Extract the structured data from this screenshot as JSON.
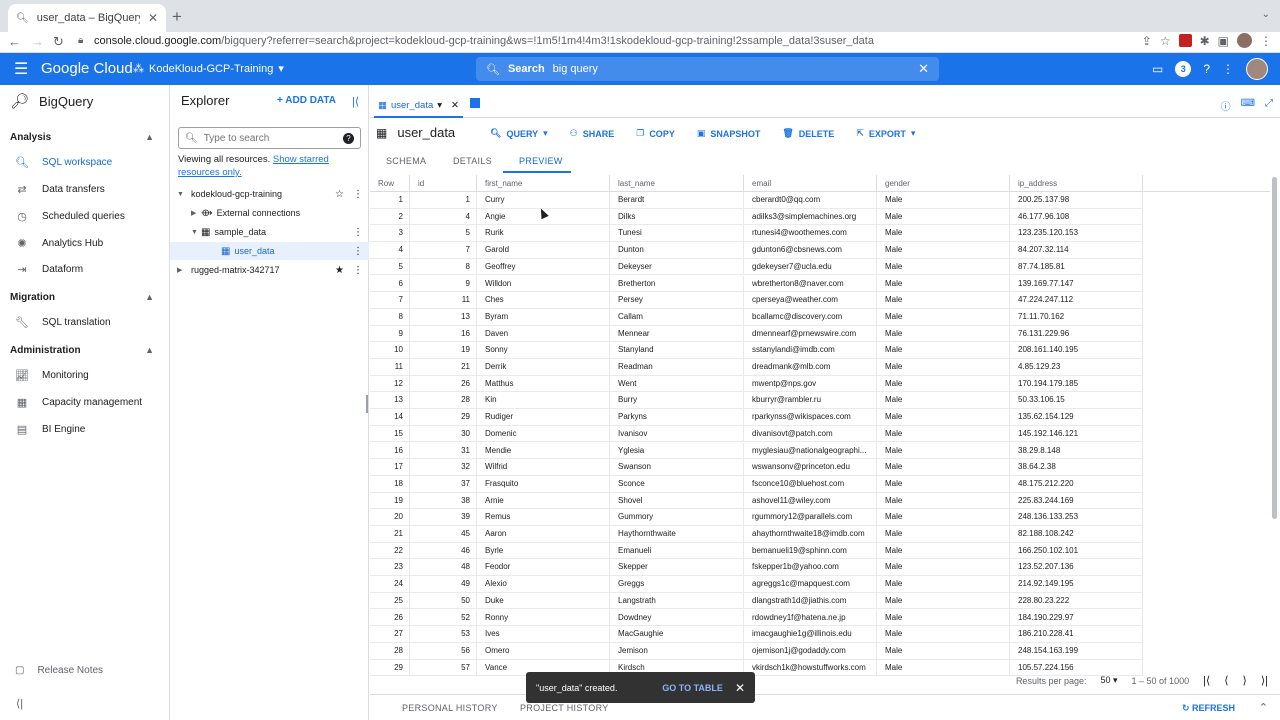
{
  "browser": {
    "tab_title": "user_data – BigQuery – Kode",
    "url_host": "console.cloud.google.com",
    "url_rest": "/bigquery?referrer=search&project=kodekloud-gcp-training&ws=!1m5!1m4!4m3!1skodekloud-gcp-training!2ssample_data!3suser_data",
    "icons": [
      "back-icon",
      "forward-icon",
      "reload-icon",
      "lock-icon",
      "new-tab-icon"
    ]
  },
  "gcp": {
    "logo": "Google Cloud",
    "project": "KodeKloud-GCP-Training",
    "search_label": "Search",
    "search_query": "big query",
    "notification_count": "3",
    "brand_color": "#1a73e8"
  },
  "leftnav": {
    "product": "BigQuery",
    "sections": [
      {
        "title": "Analysis",
        "items": [
          "SQL workspace",
          "Data transfers",
          "Scheduled queries",
          "Analytics Hub",
          "Dataform"
        ]
      },
      {
        "title": "Migration",
        "items": [
          "SQL translation"
        ]
      },
      {
        "title": "Administration",
        "items": [
          "Monitoring",
          "Capacity management",
          "BI Engine"
        ]
      }
    ],
    "release_notes": "Release Notes"
  },
  "explorer": {
    "title": "Explorer",
    "add_data": "ADD DATA",
    "search_placeholder": "Type to search",
    "viewing": "Viewing all resources.",
    "starred_link": "Show starred resources only.",
    "tree": [
      {
        "label": "kodekloud-gcp-training"
      },
      {
        "label": "External connections"
      },
      {
        "label": "sample_data"
      },
      {
        "label": "user_data"
      },
      {
        "label": "rugged-matrix-342717"
      }
    ]
  },
  "main": {
    "tab_label": "user_data",
    "table_name": "user_data",
    "toolbar": [
      "QUERY",
      "SHARE",
      "COPY",
      "SNAPSHOT",
      "DELETE",
      "EXPORT"
    ],
    "subtabs": [
      "SCHEMA",
      "DETAILS",
      "PREVIEW"
    ],
    "columns": [
      "Row",
      "id",
      "first_name",
      "last_name",
      "email",
      "gender",
      "ip_address"
    ],
    "rows": [
      [
        "1",
        "1",
        "Curry",
        "Berardt",
        "cberardt0@qq.com",
        "Male",
        "200.25.137.98"
      ],
      [
        "2",
        "4",
        "Angie",
        "Dilks",
        "adilks3@simplemachines.org",
        "Male",
        "46.177.96.108"
      ],
      [
        "3",
        "5",
        "Rurik",
        "Tunesi",
        "rtunesi4@woothemes.com",
        "Male",
        "123.235.120.153"
      ],
      [
        "4",
        "7",
        "Garold",
        "Dunton",
        "gdunton6@cbsnews.com",
        "Male",
        "84.207.32.114"
      ],
      [
        "5",
        "8",
        "Geoffrey",
        "Dekeyser",
        "gdekeyser7@ucla.edu",
        "Male",
        "87.74.185.81"
      ],
      [
        "6",
        "9",
        "Willdon",
        "Bretherton",
        "wbretherton8@naver.com",
        "Male",
        "139.169.77.147"
      ],
      [
        "7",
        "11",
        "Ches",
        "Persey",
        "cperseya@weather.com",
        "Male",
        "47.224.247.112"
      ],
      [
        "8",
        "13",
        "Byram",
        "Callam",
        "bcallamc@discovery.com",
        "Male",
        "71.11.70.162"
      ],
      [
        "9",
        "16",
        "Daven",
        "Mennear",
        "dmennearf@prnewswire.com",
        "Male",
        "76.131.229.96"
      ],
      [
        "10",
        "19",
        "Sonny",
        "Stanyland",
        "sstanylandi@imdb.com",
        "Male",
        "208.161.140.195"
      ],
      [
        "11",
        "21",
        "Derrik",
        "Readman",
        "dreadmank@mlb.com",
        "Male",
        "4.85.129.23"
      ],
      [
        "12",
        "26",
        "Matthus",
        "Went",
        "mwentp@nps.gov",
        "Male",
        "170.194.179.185"
      ],
      [
        "13",
        "28",
        "Kin",
        "Burry",
        "kburryr@rambler.ru",
        "Male",
        "50.33.106.15"
      ],
      [
        "14",
        "29",
        "Rudiger",
        "Parkyns",
        "rparkynss@wikispaces.com",
        "Male",
        "135.62.154.129"
      ],
      [
        "15",
        "30",
        "Domenic",
        "Ivanisov",
        "divanisovt@patch.com",
        "Male",
        "145.192.146.121"
      ],
      [
        "16",
        "31",
        "Mendie",
        "Yglesia",
        "myglesiau@nationalgeographi...",
        "Male",
        "38.29.8.148"
      ],
      [
        "17",
        "32",
        "Wilfrid",
        "Swanson",
        "wswansonv@princeton.edu",
        "Male",
        "38.64.2.38"
      ],
      [
        "18",
        "37",
        "Frasquito",
        "Sconce",
        "fsconce10@bluehost.com",
        "Male",
        "48.175.212.220"
      ],
      [
        "19",
        "38",
        "Arnie",
        "Shovel",
        "ashovel11@wiley.com",
        "Male",
        "225.83.244.169"
      ],
      [
        "20",
        "39",
        "Remus",
        "Gummory",
        "rgummory12@parallels.com",
        "Male",
        "248.136.133.253"
      ],
      [
        "21",
        "45",
        "Aaron",
        "Haythornthwaite",
        "ahaythornthwaite18@imdb.com",
        "Male",
        "82.188.108.242"
      ],
      [
        "22",
        "46",
        "Byrle",
        "Emanueli",
        "bemanueli19@sphinn.com",
        "Male",
        "166.250.102.101"
      ],
      [
        "23",
        "48",
        "Feodor",
        "Skepper",
        "fskepper1b@yahoo.com",
        "Male",
        "123.52.207.136"
      ],
      [
        "24",
        "49",
        "Alexio",
        "Greggs",
        "agreggs1c@mapquest.com",
        "Male",
        "214.92.149.195"
      ],
      [
        "25",
        "50",
        "Duke",
        "Langstrath",
        "dlangstrath1d@jiathis.com",
        "Male",
        "228.80.23.222"
      ],
      [
        "26",
        "52",
        "Ronny",
        "Dowdney",
        "rdowdney1f@hatena.ne.jp",
        "Male",
        "184.190.229.97"
      ],
      [
        "27",
        "53",
        "Ives",
        "MacGaughie",
        "imacgaughie1g@illinois.edu",
        "Male",
        "186.210.228.41"
      ],
      [
        "28",
        "56",
        "Omero",
        "Jemison",
        "ojemison1j@godaddy.com",
        "Male",
        "248.154.163.199"
      ],
      [
        "29",
        "57",
        "Vance",
        "Kirdsch",
        "vkirdsch1k@howstuffworks.com",
        "Male",
        "105.57.224.156"
      ]
    ],
    "results_per_page_label": "Results per page:",
    "results_per_page": "50",
    "range": "1 – 50 of 1000",
    "bottom_tabs": [
      "PERSONAL HISTORY",
      "PROJECT HISTORY"
    ],
    "refresh": "REFRESH"
  },
  "toast": {
    "message": "\"user_data\" created.",
    "action": "GO TO TABLE"
  }
}
